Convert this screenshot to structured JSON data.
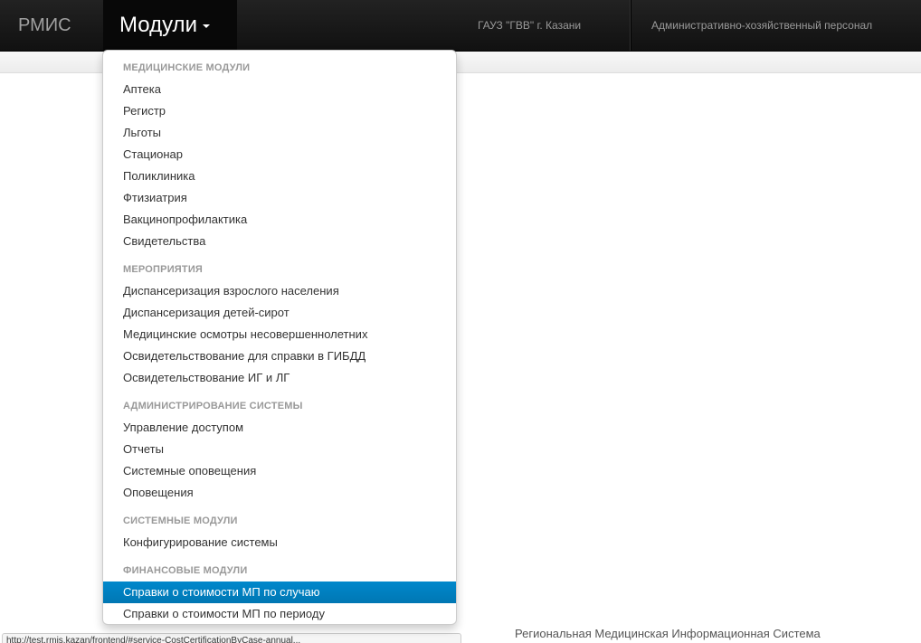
{
  "navbar": {
    "brand": "РМИС",
    "modules_label": "Модули",
    "organization": "ГАУЗ \"ГВВ\" г. Казани",
    "role": "Административно-хозяйственный персонал"
  },
  "dropdown": {
    "sections": [
      {
        "header": "МЕДИЦИНСКИЕ МОДУЛИ",
        "items": [
          "Аптека",
          "Регистр",
          "Льготы",
          "Стационар",
          "Поликлиника",
          "Фтизиатрия",
          "Вакцинопрофилактика",
          "Свидетельства"
        ]
      },
      {
        "header": "МЕРОПРИЯТИЯ",
        "items": [
          "Диспансеризация взрослого населения",
          "Диспансеризация детей-сирот",
          "Медицинские осмотры несовершеннолетних",
          "Освидетельствование для справки в ГИБДД",
          "Освидетельствование ИГ и ЛГ"
        ]
      },
      {
        "header": "АДМИНИСТРИРОВАНИЕ СИСТЕМЫ",
        "items": [
          "Управление доступом",
          "Отчеты",
          "Системные оповещения",
          "Оповещения"
        ]
      },
      {
        "header": "СИСТЕМНЫЕ МОДУЛИ",
        "items": [
          "Конфигурирование системы"
        ]
      },
      {
        "header": "ФИНАНСОВЫЕ МОДУЛИ",
        "items": [
          "Справки о стоимости МП по случаю",
          "Справки о стоимости МП по периоду"
        ]
      }
    ],
    "active_item": "Справки о стоимости МП по случаю"
  },
  "statusbar": {
    "url": "http://test.rmis.kazan/frontend/#service-CostCertificationByCase-annual..."
  },
  "footer": {
    "text": "Региональная Медицинская Информационная Система"
  },
  "colors": {
    "navbar": "#111111",
    "active_item": "#0081c2",
    "header_text": "#999999"
  }
}
